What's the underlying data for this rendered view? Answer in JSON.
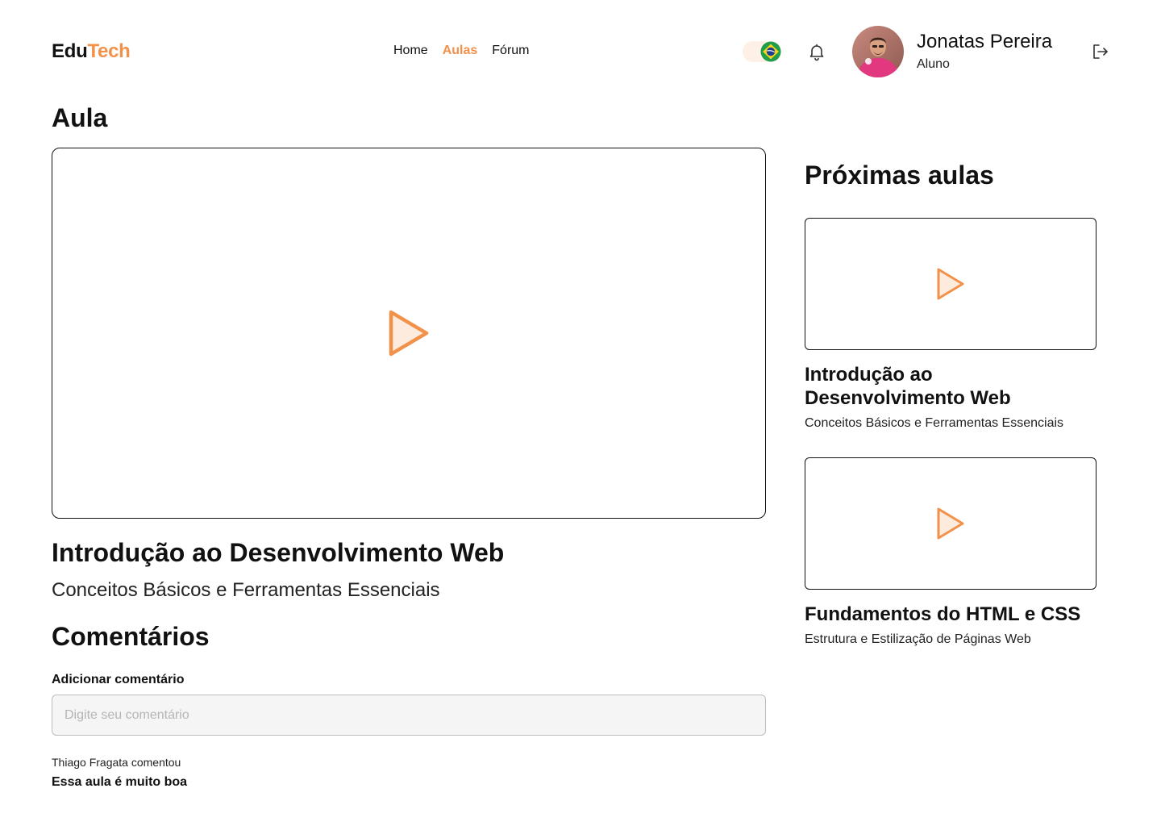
{
  "brand": {
    "part1": "Edu",
    "part2": "Tech",
    "accent_color": "#F2914A"
  },
  "nav": {
    "items": [
      {
        "label": "Home",
        "active": false
      },
      {
        "label": "Aulas",
        "active": true
      },
      {
        "label": "Fórum",
        "active": false
      }
    ]
  },
  "header": {
    "language_flag": "brazil-flag-icon",
    "notification_icon": "bell-icon",
    "logout_icon": "logout-icon"
  },
  "user": {
    "name": "Jonatas Pereira",
    "role": "Aluno"
  },
  "main": {
    "page_title": "Aula",
    "video_icon": "play-icon",
    "lesson_title": "Introdução ao Desenvolvimento Web",
    "lesson_subtitle": "Conceitos Básicos e Ferramentas Essenciais"
  },
  "comments": {
    "title": "Comentários",
    "add_label": "Adicionar comentário",
    "input_placeholder": "Digite seu comentário",
    "items": [
      {
        "author_line": "Thiago Fragata comentou",
        "text": "Essa aula é muito boa"
      }
    ]
  },
  "sidebar": {
    "title": "Próximas aulas",
    "lessons": [
      {
        "title": "Introdução ao Desenvolvimento Web",
        "subtitle": "Conceitos Básicos e Ferramentas Essenciais"
      },
      {
        "title": "Fundamentos do HTML e CSS",
        "subtitle": "Estrutura e Estilização de Páginas Web"
      }
    ]
  }
}
